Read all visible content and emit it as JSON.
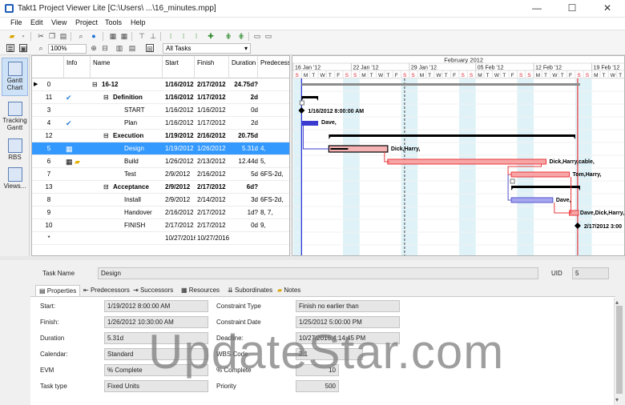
{
  "window": {
    "title": "Takt1 Project Viewer Lite [C:\\Users\\ ...\\16_minutes.mpp]",
    "minimize": "—",
    "maximize": "☐",
    "close": "✕"
  },
  "menu": [
    "File",
    "Edit",
    "View",
    "Project",
    "Tools",
    "Help"
  ],
  "toolbar": {
    "zoom": "100%",
    "filter": "All Tasks"
  },
  "views": [
    {
      "label": "Gantt Chart"
    },
    {
      "label": "Tracking Gantt"
    },
    {
      "label": "RBS"
    },
    {
      "label": "Views..."
    }
  ],
  "grid": {
    "columns": [
      "Info",
      "Name",
      "Start",
      "Finish",
      "Duration",
      "Predecess"
    ],
    "rows": [
      {
        "id": "0",
        "name": "16-12",
        "start": "1/16/2012",
        "finish": "2/17/2012",
        "duration": "24.75d?",
        "pred": "",
        "bold": true,
        "level": 0,
        "summary": true
      },
      {
        "id": "11",
        "name": "Definition",
        "start": "1/16/2012",
        "finish": "1/17/2012",
        "duration": "2d",
        "pred": "",
        "bold": true,
        "level": 1,
        "summary": true,
        "check": true
      },
      {
        "id": "3",
        "name": "START",
        "start": "1/16/2012",
        "finish": "1/16/2012",
        "duration": "0d",
        "pred": "",
        "level": 2
      },
      {
        "id": "4",
        "name": "Plan",
        "start": "1/16/2012",
        "finish": "1/17/2012",
        "duration": "2d",
        "pred": "",
        "level": 2,
        "check": true
      },
      {
        "id": "12",
        "name": "Execution",
        "start": "1/19/2012",
        "finish": "2/16/2012",
        "duration": "20.75d",
        "pred": "",
        "bold": true,
        "level": 1,
        "summary": true
      },
      {
        "id": "5",
        "name": "Design",
        "start": "1/19/2012",
        "finish": "1/26/2012",
        "duration": "5.31d",
        "pred": "4,",
        "level": 2,
        "selected": true
      },
      {
        "id": "6",
        "name": "Build",
        "start": "1/26/2012",
        "finish": "2/13/2012",
        "duration": "12.44d",
        "pred": "5,",
        "level": 2
      },
      {
        "id": "7",
        "name": "Test",
        "start": "2/9/2012",
        "finish": "2/16/2012",
        "duration": "5d",
        "pred": "6FS-2d,",
        "level": 2
      },
      {
        "id": "13",
        "name": "Acceptance",
        "start": "2/9/2012",
        "finish": "2/17/2012",
        "duration": "6d?",
        "pred": "",
        "bold": true,
        "level": 1,
        "summary": true
      },
      {
        "id": "8",
        "name": "Install",
        "start": "2/9/2012",
        "finish": "2/14/2012",
        "duration": "3d",
        "pred": "6FS-2d,",
        "level": 2
      },
      {
        "id": "9",
        "name": "Handover",
        "start": "2/16/2012",
        "finish": "2/17/2012",
        "duration": "1d?",
        "pred": "8, 7,",
        "level": 2
      },
      {
        "id": "10",
        "name": "FINISH",
        "start": "2/17/2012",
        "finish": "2/17/2012",
        "duration": "0d",
        "pred": "9,",
        "level": 2
      },
      {
        "id": "*",
        "name": "",
        "start": "10/27/2016",
        "finish": "10/27/2016",
        "duration": "",
        "pred": "",
        "level": 0
      }
    ]
  },
  "gantt": {
    "month_label": "February 2012",
    "weeks": [
      "16 Jan '12",
      "22 Jan '12",
      "29 Jan '12",
      "05 Feb '12",
      "12 Feb '12",
      "19 Feb '12"
    ],
    "days": [
      "S",
      "M",
      "T",
      "W",
      "T",
      "F",
      "S"
    ],
    "labels": [
      "1/16/2012 8:00:00 AM",
      "Dave,",
      "Dick,Harry,",
      "Dick,Harry,cable,",
      "Tom,Harry,",
      "Dave,",
      "Dave,Dick,Harry,",
      "2/17/2012 3:00"
    ]
  },
  "detail": {
    "task_name_label": "Task Name",
    "task_name": "Design",
    "uid_label": "UID",
    "uid": "5",
    "tabs": [
      "Properties",
      "Predecessors",
      "Successors",
      "Resources",
      "Subordinates",
      "Notes"
    ],
    "left": [
      {
        "label": "Start:",
        "value": "1/19/2012 8:00:00 AM"
      },
      {
        "label": "Finish:",
        "value": "1/26/2012 10:30:00 AM"
      },
      {
        "label": "Duration",
        "value": "5.31d"
      },
      {
        "label": "Calendar:",
        "value": "Standard"
      },
      {
        "label": "EVM",
        "value": "% Complete"
      },
      {
        "label": "Task type",
        "value": "Fixed Units"
      }
    ],
    "right": [
      {
        "label": "Constraint Type",
        "value": "Finish no earlier than"
      },
      {
        "label": "Constraint Date",
        "value": "1/25/2012 5:00:00 PM"
      },
      {
        "label": "Deadline:",
        "value": "10/27/2016 4:14:45 PM"
      },
      {
        "label": "WBS Code",
        "value": "2.1"
      },
      {
        "label": "% Complete",
        "value": "10"
      },
      {
        "label": "Priority",
        "value": "500"
      }
    ]
  },
  "watermark": "UpdateStar.com",
  "colors": {
    "selection": "#3399ff",
    "critical": "#e8383d",
    "task": "#6b6bdb",
    "summary": "#000000"
  }
}
